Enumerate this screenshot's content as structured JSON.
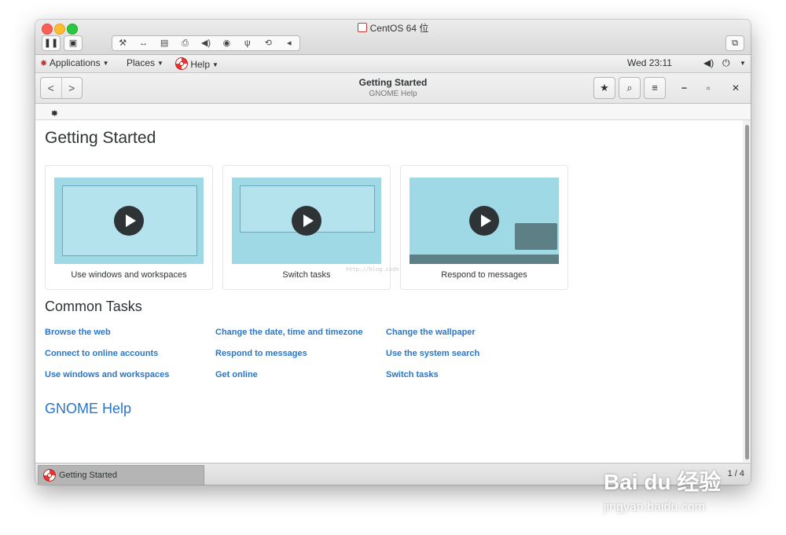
{
  "vm": {
    "title": "CentOS 64 位",
    "toolbar_icons": [
      "pause-icon",
      "snapshot-icon",
      "settings-wrench-icon",
      "network-icon",
      "disk-icon",
      "printer-icon",
      "sound-icon",
      "camera-icon",
      "usb-icon",
      "share-icon",
      "more-icon",
      "fullscreen-icon"
    ],
    "group_glyphs": [
      "🔧",
      "↔",
      "💾",
      "⏏",
      "🔊",
      "◉",
      "⚲",
      "⟲",
      "◂"
    ]
  },
  "topbar": {
    "applications": "Applications",
    "places": "Places",
    "help": "Help",
    "clock": "Wed 23:11"
  },
  "header": {
    "back": "<",
    "forward": ">",
    "title": "Getting Started",
    "subtitle": "GNOME Help",
    "bookmark": "★",
    "search": "🔍",
    "menu": "≡",
    "minimize": "−",
    "maximize": "▫",
    "close": "✕"
  },
  "breadcrumb": "» ",
  "page": {
    "title": "Getting Started",
    "cards": [
      {
        "caption": "Use windows and workspaces"
      },
      {
        "caption": "Switch tasks"
      },
      {
        "caption": "Respond to messages"
      }
    ],
    "watermark_url": "http://blog.csdn.net/lishi_li",
    "common_tasks_title": "Common Tasks",
    "tasks": [
      [
        "Browse the web",
        "Change the date, time and timezone",
        "Change the wallpaper"
      ],
      [
        "Connect to online accounts",
        "Respond to messages",
        "Use the system search"
      ],
      [
        "Use windows and workspaces",
        "Get online",
        "Switch tasks"
      ]
    ],
    "gnome_help_link": "GNOME Help"
  },
  "taskbar": {
    "task_label": "Getting Started",
    "pager": "1 / 4"
  },
  "overlay": {
    "brand": "Bai du 经验",
    "site": "jingyan.baidu.com"
  }
}
